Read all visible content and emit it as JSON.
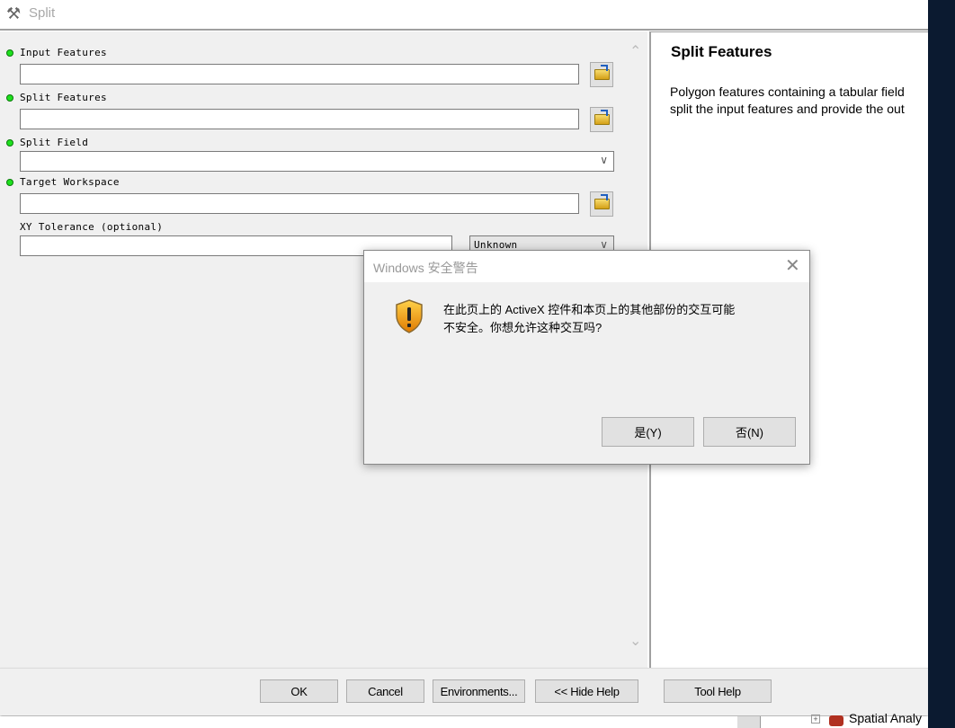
{
  "window": {
    "title": "Split",
    "icon": "hammer-icon"
  },
  "params": [
    {
      "label": "Input Features",
      "required": true,
      "value": ""
    },
    {
      "label": "Split Features",
      "required": true,
      "value": ""
    },
    {
      "label": "Split Field",
      "required": true,
      "value": ""
    },
    {
      "label": "Target Workspace",
      "required": true,
      "value": ""
    },
    {
      "label": "XY Tolerance (optional)",
      "required": false,
      "value": "",
      "unit": "Unknown"
    }
  ],
  "help": {
    "title": "Split Features",
    "body_line1": "Polygon features containing a tabular field",
    "body_line2": "split the input features and provide the out"
  },
  "buttons": {
    "ok": "OK",
    "cancel": "Cancel",
    "environments": "Environments...",
    "hide_help": "<< Hide Help",
    "tool_help": "Tool Help"
  },
  "background_tree": {
    "item": "Spatial Analy"
  },
  "dialog": {
    "title": "Windows 安全警告",
    "message_line1": "在此页上的 ActiveX 控件和本页上的其他部份的交互可能",
    "message_line2": "不安全。你想允许这种交互吗?",
    "yes": "是(Y)",
    "no": "否(N)",
    "icon": "warning-shield-icon"
  },
  "colors": {
    "required_dot": "#1ee01e",
    "dark_strip": "#0b1a30"
  }
}
